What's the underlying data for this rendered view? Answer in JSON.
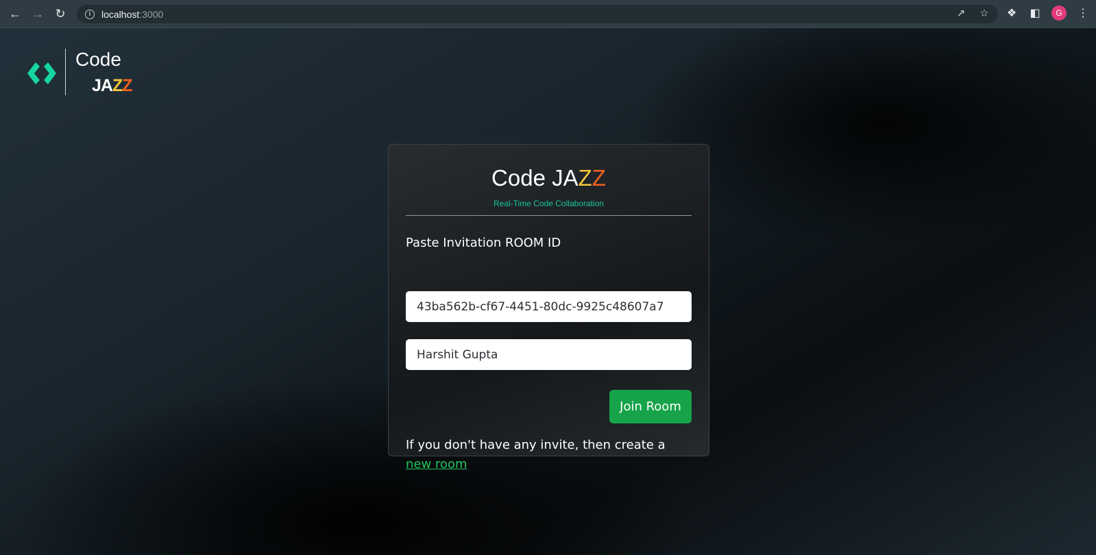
{
  "browser": {
    "url_host": "localhost",
    "url_port": ":3000",
    "avatar_initial": "G"
  },
  "logo": {
    "code": "Code",
    "jazz": [
      "JA",
      "Z",
      "Z"
    ],
    "mark_color": "#16d6a0"
  },
  "card": {
    "title_prefix": "Code JA",
    "title_z1": "Z",
    "title_z2": "Z",
    "subtitle": "Real-Time Code Collaboration",
    "room_label": "Paste Invitation ROOM ID",
    "room_id_value": "43ba562b-cf67-4451-80dc-9925c48607a7",
    "username_value": "Harshit Gupta",
    "join_button": "Join Room",
    "invite_text": "If you don't have any invite, then create a ",
    "new_room_link": "new room"
  },
  "colors": {
    "accent_green": "#16a34a",
    "teal": "#16c79a",
    "jazz_yellow": "#f5c53a",
    "jazz_orange": "#f2611f"
  }
}
